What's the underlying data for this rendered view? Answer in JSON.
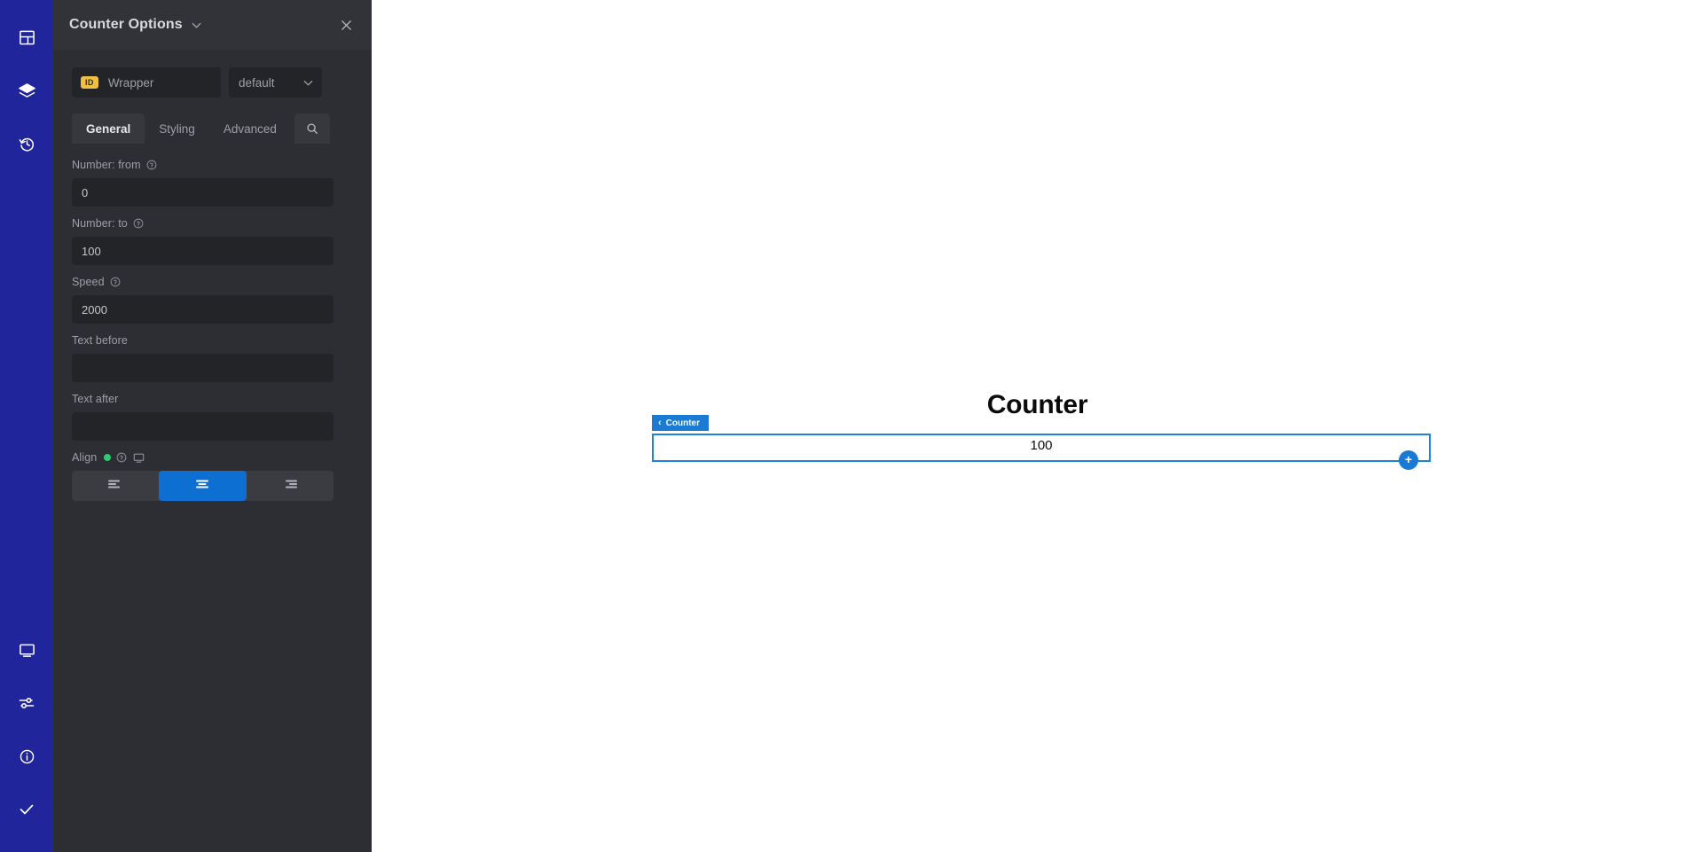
{
  "rail": {
    "top_items": [
      {
        "name": "layout-icon",
        "label": "Layout"
      },
      {
        "name": "layers-icon",
        "label": "Layers"
      },
      {
        "name": "history-icon",
        "label": "History"
      }
    ],
    "bottom_items": [
      {
        "name": "monitor-icon",
        "label": "Responsive"
      },
      {
        "name": "sliders-icon",
        "label": "Settings"
      },
      {
        "name": "info-icon",
        "label": "Info"
      },
      {
        "name": "check-icon",
        "label": "Done"
      }
    ]
  },
  "panel": {
    "title": "Counter Options",
    "close_label": "×",
    "id_badge": "ID",
    "id_value": "Wrapper",
    "selector_value": "default",
    "tabs": [
      {
        "label": "General",
        "active": true
      },
      {
        "label": "Styling",
        "active": false
      },
      {
        "label": "Advanced",
        "active": false
      }
    ],
    "search_icon": "search-icon",
    "fields": [
      {
        "label": "Number: from",
        "value": "0",
        "placeholder": "",
        "has_help": true
      },
      {
        "label": "Number: to",
        "value": "100",
        "placeholder": "",
        "has_help": true
      },
      {
        "label": "Speed",
        "value": "2000",
        "placeholder": "",
        "has_help": true
      },
      {
        "label": "Text before",
        "value": "",
        "placeholder": "",
        "has_help": false
      },
      {
        "label": "Text after",
        "value": "",
        "placeholder": "",
        "has_help": false
      }
    ],
    "align": {
      "label": "Align",
      "options": [
        {
          "name": "align-left",
          "active": false
        },
        {
          "name": "align-center",
          "active": true
        },
        {
          "name": "align-right",
          "active": false
        }
      ]
    }
  },
  "canvas": {
    "heading": "Counter",
    "selected_badge": "Counter",
    "selected_badge_chevron": "‹",
    "counter_value": "100",
    "add_button_label": "+"
  },
  "colors": {
    "rail_bg": "#21259b",
    "panel_bg": "#2c2e33",
    "panel_header_bg": "#313339",
    "input_bg": "#232428",
    "accent_blue": "#0d6fd1",
    "selection_blue": "#1a84dd",
    "badge_yellow": "#f0c040",
    "status_green": "#2ecc71"
  }
}
